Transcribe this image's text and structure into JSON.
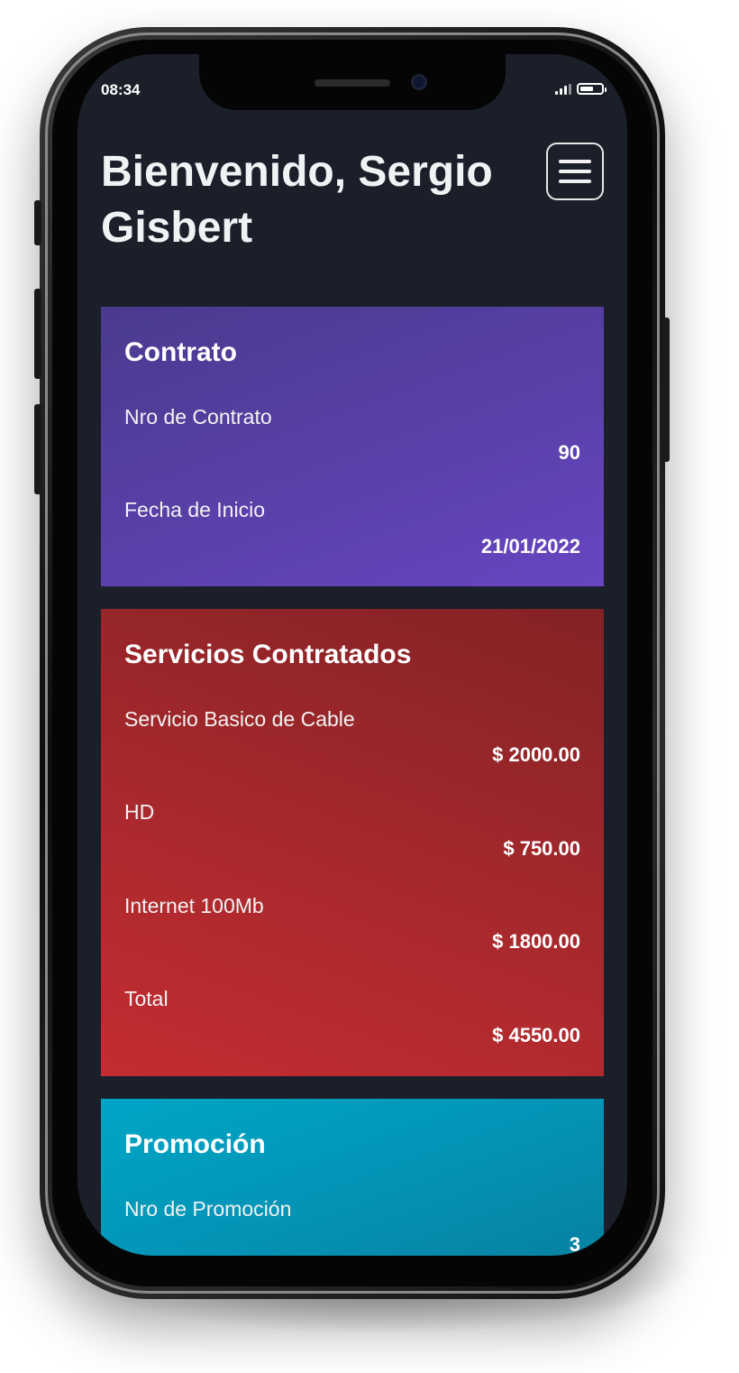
{
  "status_bar": {
    "time": "08:34"
  },
  "header": {
    "title": "Bienvenido, Sergio Gisbert"
  },
  "cards": {
    "contrato": {
      "title": "Contrato",
      "rows": [
        {
          "label": "Nro de Contrato",
          "value": "90"
        },
        {
          "label": "Fecha de Inicio",
          "value": "21/01/2022"
        }
      ]
    },
    "servicios": {
      "title": "Servicios Contratados",
      "rows": [
        {
          "label": "Servicio Basico de Cable",
          "value": "$ 2000.00"
        },
        {
          "label": "HD",
          "value": "$ 750.00"
        },
        {
          "label": "Internet 100Mb",
          "value": "$ 1800.00"
        },
        {
          "label": "Total",
          "value": "$ 4550.00"
        }
      ]
    },
    "promocion": {
      "title": "Promoción",
      "rows": [
        {
          "label": "Nro de Promoción",
          "value": "3"
        }
      ]
    }
  },
  "colors": {
    "background": "#1b1f29",
    "contrato_card": "#5a40a8",
    "servicios_card": "#a8292d",
    "promocion_card": "#0394b6"
  },
  "icons": {
    "menu": "hamburger-menu-icon",
    "signal": "signal-icon",
    "battery": "battery-icon"
  }
}
